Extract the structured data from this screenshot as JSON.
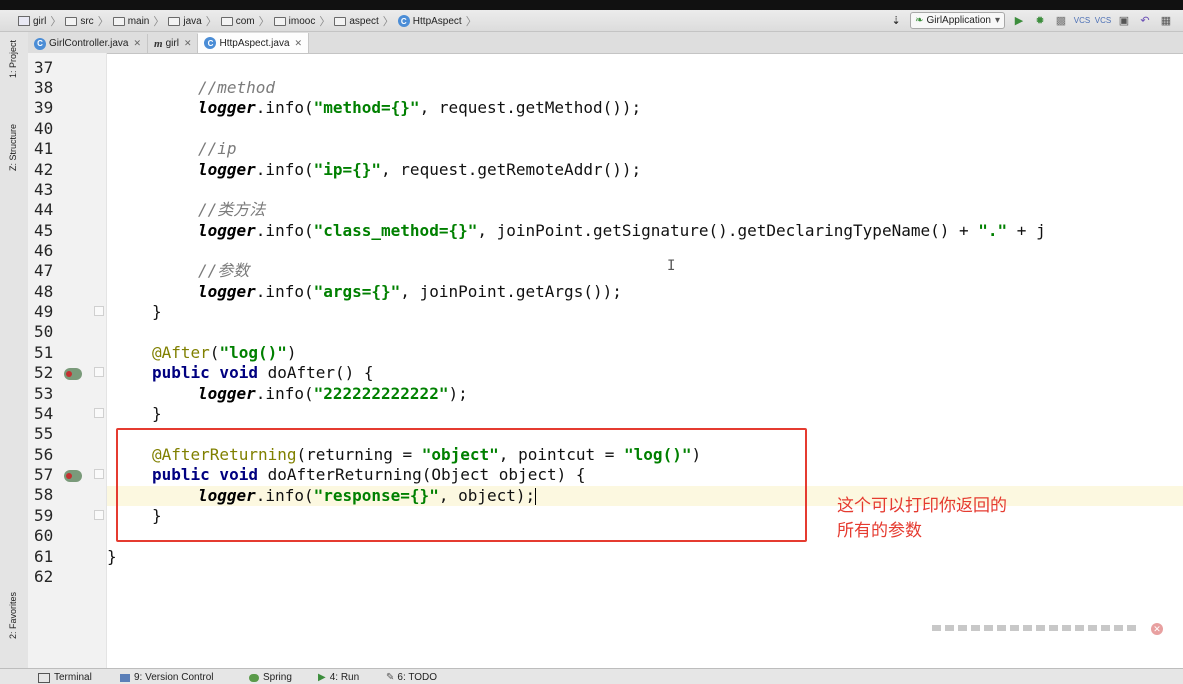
{
  "breadcrumbs": [
    {
      "label": "girl",
      "icon": "folder-icon"
    },
    {
      "label": "src",
      "icon": "folder-icon"
    },
    {
      "label": "main",
      "icon": "folder-icon"
    },
    {
      "label": "java",
      "icon": "folder-icon"
    },
    {
      "label": "com",
      "icon": "folder-icon"
    },
    {
      "label": "imooc",
      "icon": "folder-icon"
    },
    {
      "label": "aspect",
      "icon": "folder-icon"
    },
    {
      "label": "HttpAspect",
      "icon": "class-icon"
    }
  ],
  "toolbar": {
    "run_config": "GirlApplication"
  },
  "tabs": [
    {
      "label": "GirlController.java",
      "icon": "C"
    },
    {
      "label": "girl",
      "icon": "m"
    },
    {
      "label": "HttpAspect.java",
      "icon": "C"
    }
  ],
  "toolwindows": {
    "project": "1: Project",
    "structure": "Z: Structure",
    "favorites": "2: Favorites"
  },
  "lines": [
    "37",
    "38",
    "39",
    "40",
    "41",
    "42",
    "43",
    "44",
    "45",
    "46",
    "47",
    "48",
    "49",
    "50",
    "51",
    "52",
    "53",
    "54",
    "55",
    "56",
    "57",
    "58",
    "59",
    "60",
    "61",
    "62"
  ],
  "code": {
    "c38": "//method",
    "l39_field": "logger",
    "l39_call": ".info(",
    "l39_str": "\"method={}\"",
    "l39_rest": ", request.getMethod());",
    "c41": "//ip",
    "l42_field": "logger",
    "l42_call": ".info(",
    "l42_str": "\"ip={}\"",
    "l42_rest": ", request.getRemoteAddr());",
    "c44": "//类方法",
    "l45_field": "logger",
    "l45_call": ".info(",
    "l45_str": "\"class_method={}\"",
    "l45_rest": ", joinPoint.getSignature().getDeclaringTypeName() + ",
    "l45_str2": "\".\"",
    "l45_tail": " + j",
    "c47": "//参数",
    "l48_field": "logger",
    "l48_call": ".info(",
    "l48_str": "\"args={}\"",
    "l48_rest": ", joinPoint.getArgs());",
    "l49": "}",
    "l51_ann": "@After",
    "l51_open": "(",
    "l51_str": "\"log()\"",
    "l51_close": ")",
    "l52_kw": "public void",
    "l52_rest": " doAfter() {",
    "l53_field": "logger",
    "l53_call": ".info(",
    "l53_str": "\"222222222222\"",
    "l53_rest": ");",
    "l54": "}",
    "l56_ann": "@AfterReturning",
    "l56_a": "(returning = ",
    "l56_str1": "\"object\"",
    "l56_b": ", pointcut = ",
    "l56_str2": "\"log()\"",
    "l56_c": ")",
    "l57_kw": "public void",
    "l57_rest": " doAfterReturning(Object object) {",
    "l58_field": "logger",
    "l58_call": ".info(",
    "l58_str": "\"response={}\"",
    "l58_rest": ", object);",
    "l59": "}",
    "l61": "}"
  },
  "annotation_note": [
    "这个可以打印你返回的",
    "所有的参数"
  ],
  "statusbar": [
    "Terminal",
    "9: Version Control",
    "Spring",
    "4: Run",
    "6: TODO"
  ]
}
